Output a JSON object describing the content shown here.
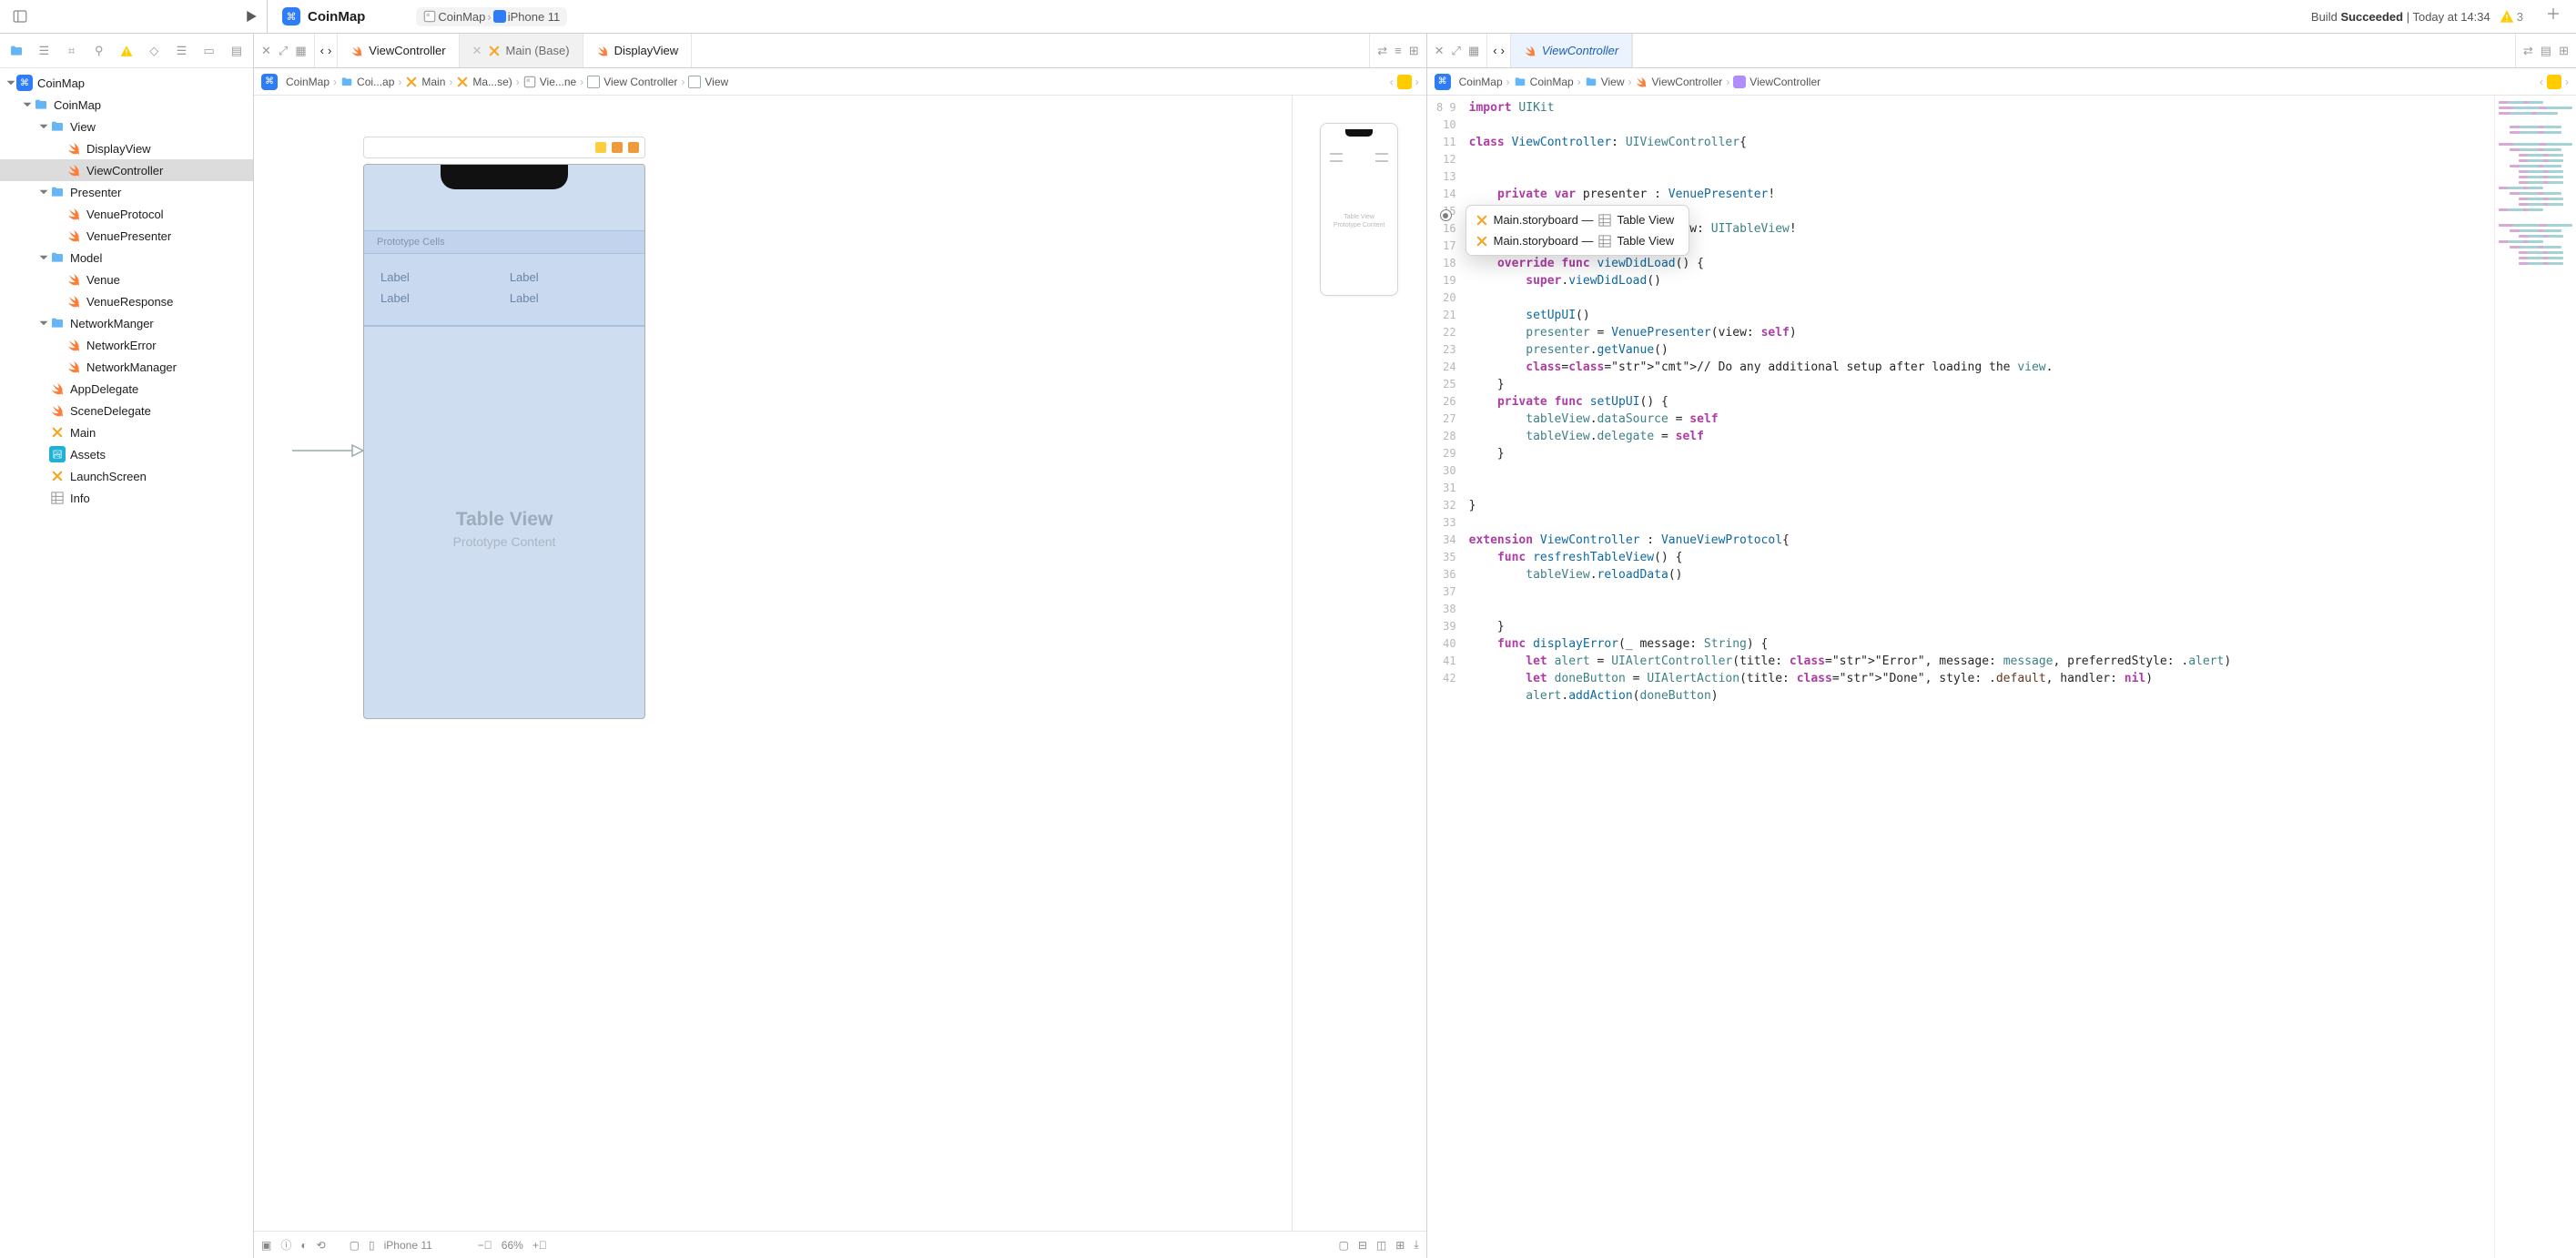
{
  "toolbar": {
    "project_title": "CoinMap",
    "scheme_target": "CoinMap",
    "scheme_device": "iPhone 11",
    "status_prefix": "Build ",
    "status_result": "Succeeded",
    "status_sep": " | ",
    "status_time": "Today at 14:34",
    "warning_count": "3"
  },
  "navigator": {
    "root": "CoinMap",
    "group_root": "CoinMap",
    "view_group": "View",
    "display_view": "DisplayView",
    "view_controller": "ViewController",
    "presenter_group": "Presenter",
    "venue_protocol": "VenueProtocol",
    "venue_presenter": "VenuePresenter",
    "model_group": "Model",
    "venue": "Venue",
    "venue_response": "VenueResponse",
    "network_group": "NetworkManger",
    "network_error": "NetworkError",
    "network_manager": "NetworkManager",
    "app_delegate": "AppDelegate",
    "scene_delegate": "SceneDelegate",
    "main_storyboard": "Main",
    "assets": "Assets",
    "launch_screen": "LaunchScreen",
    "info_plist": "Info"
  },
  "left_editor": {
    "tab1": "ViewController",
    "tab2": "Main (Base)",
    "tab3": "DisplayView",
    "jump": {
      "s1": "CoinMap",
      "s2": "Coi...ap",
      "s3": "Main",
      "s4": "Ma...se)",
      "s5": "Vie...ne",
      "s6": "View Controller",
      "s7": "View"
    },
    "ib": {
      "proto_header": "Prototype Cells",
      "label": "Label",
      "tv_title": "Table View",
      "tv_sub": "Prototype Content",
      "footer_device": "iPhone 11",
      "zoom": "66%",
      "mini_title": "Table View",
      "mini_sub": "Prototype Content"
    }
  },
  "right_editor": {
    "tab1": "ViewController",
    "jump": {
      "s1": "CoinMap",
      "s2": "CoinMap",
      "s3": "View",
      "s4": "ViewController",
      "s5": "ViewController"
    },
    "popup": {
      "row1": "Main.storyboard — ",
      "row1_suffix": "Table View",
      "row2": "Main.storyboard — ",
      "row2_suffix": "Table View"
    },
    "code_lines": [
      "import UIKit",
      "",
      "class ViewController: UIViewController{",
      "",
      "",
      "    private var presenter : VenuePresenter!",
      "",
      "    @IBOutlet weak var tableView: UITableView!",
      "",
      "    override func viewDidLoad() {",
      "        super.viewDidLoad()",
      "",
      "        setUpUI()",
      "        presenter = VenuePresenter(view: self)",
      "        presenter.getVanue()",
      "        // Do any additional setup after loading the view.",
      "    }",
      "    private func setUpUI() {",
      "        tableView.dataSource = self",
      "        tableView.delegate = self",
      "    }",
      "",
      "",
      "}",
      "",
      "extension ViewController : VanueViewProtocol{",
      "    func resfreshTableView() {",
      "        tableView.reloadData()",
      "",
      "",
      "    }",
      "    func displayError(_ message: String) {",
      "        let alert = UIAlertController(title: \"Error\", message: message, preferredStyle: .alert)",
      "        let doneButton = UIAlertAction(title: \"Done\", style: .default, handler: nil)",
      "        alert.addAction(doneButton)"
    ],
    "line_start": 8
  }
}
